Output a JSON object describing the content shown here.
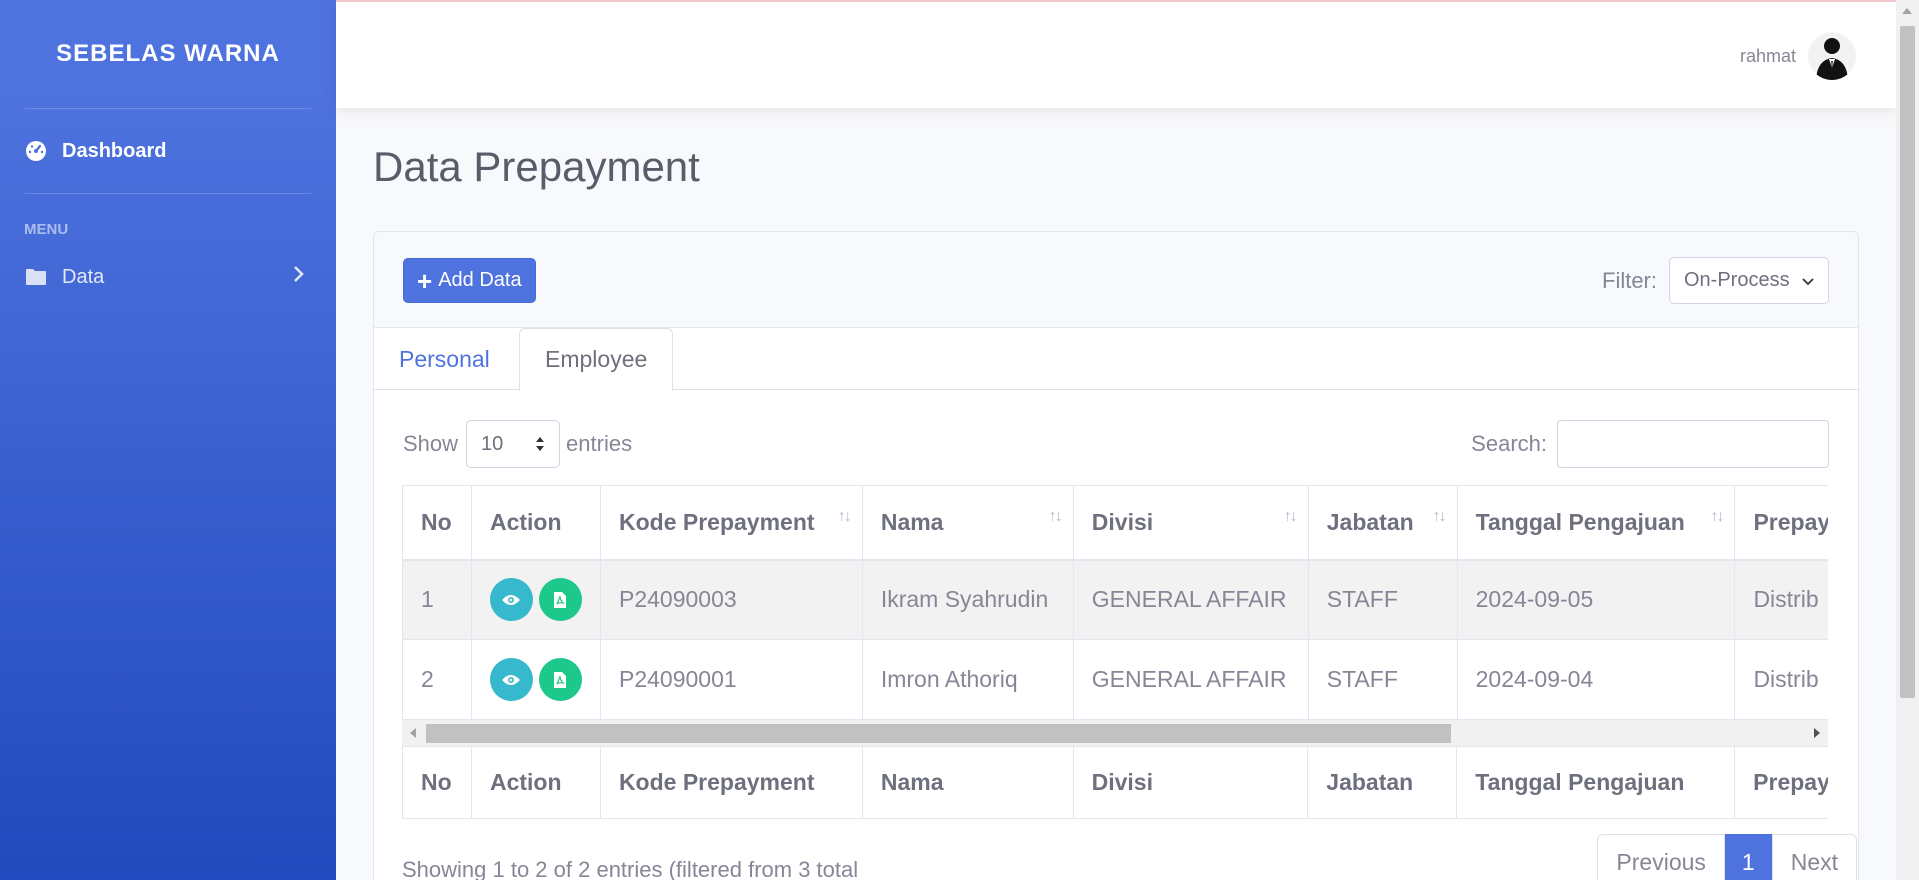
{
  "sidebar": {
    "brand": "SEBELAS WARNA",
    "dashboard_label": "Dashboard",
    "menu_heading": "MENU",
    "data_label": "Data"
  },
  "topbar": {
    "user_name": "rahmat"
  },
  "page": {
    "title": "Data Prepayment"
  },
  "card": {
    "add_button": "Add Data",
    "filter_label": "Filter:",
    "filter_value": "On-Process"
  },
  "tabs": {
    "personal": "Personal",
    "employee": "Employee"
  },
  "controls": {
    "show_label": "Show",
    "entries_value": "10",
    "entries_label": "entries",
    "search_label": "Search:"
  },
  "table": {
    "headers": [
      "No",
      "Action",
      "Kode Prepayment",
      "Nama",
      "Divisi",
      "Jabatan",
      "Tanggal Pengajuan",
      "Prepay"
    ],
    "rows": [
      {
        "no": "1",
        "kode": "P24090003",
        "nama": "Ikram Syahrudin",
        "divisi": "GENERAL AFFAIR",
        "jabatan": "STAFF",
        "tanggal": "2024-09-05",
        "prepay": "Distrib"
      },
      {
        "no": "2",
        "kode": "P24090001",
        "nama": "Imron Athoriq",
        "divisi": "GENERAL AFFAIR",
        "jabatan": "STAFF",
        "tanggal": "2024-09-04",
        "prepay": "Distrib"
      }
    ]
  },
  "footer": {
    "info": "Showing 1 to 2 of 2 entries (filtered from 3 total",
    "previous": "Previous",
    "current_page": "1",
    "next": "Next"
  },
  "icons": {
    "dashboard": "tachometer-icon",
    "data": "folder-icon",
    "view": "eye-icon",
    "pdf": "file-pdf-icon"
  },
  "colors": {
    "primary": "#4e73df",
    "info": "#36b9cc",
    "success": "#1cc88a"
  }
}
